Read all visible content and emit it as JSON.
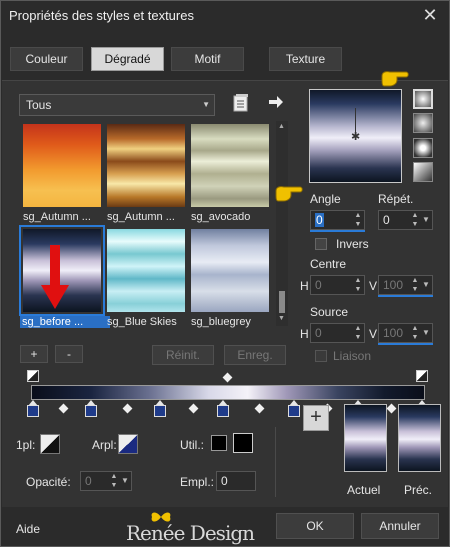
{
  "window": {
    "title": "Propriétés des styles et textures",
    "close": "✕"
  },
  "tabs": [
    "Couleur",
    "Dégradé",
    "Motif",
    "Texture"
  ],
  "library": {
    "category": "Tous",
    "thumbnails": [
      {
        "label": "sg_Autumn ..."
      },
      {
        "label": "sg_Autumn ..."
      },
      {
        "label": "sg_avocado"
      },
      {
        "label": "sg_before ..."
      },
      {
        "label": "sg_Blue Skies"
      },
      {
        "label": "sg_bluegrey"
      }
    ],
    "add": "+",
    "remove": "-",
    "reset": "Réinit.",
    "save": "Enreg."
  },
  "settings": {
    "angle_label": "Angle",
    "angle_value": "0",
    "repeat_label": "Répét.",
    "repeat_value": "0",
    "invert_label": "Invers",
    "center_label": "Centre",
    "center_h": "0",
    "center_v": "100",
    "source_label": "Source",
    "source_h": "0",
    "source_v": "100",
    "h": "H",
    "v": "V",
    "link_label": "Liaison"
  },
  "bottom": {
    "onepl": "1pl:",
    "arpl": "Arpl:",
    "util": "Util.:",
    "opacity_label": "Opacité:",
    "opacity_value": "0",
    "empl_label": "Empl.:",
    "empl_value": "0",
    "plus": "+",
    "current": "Actuel",
    "previous": "Préc."
  },
  "footer": {
    "help": "Aide",
    "brand": "Renée Design",
    "ok": "OK",
    "cancel": "Annuler"
  },
  "colors": {
    "accent": "#2a7bd8",
    "arrow": "#e01010",
    "hand": "#f0c000"
  }
}
